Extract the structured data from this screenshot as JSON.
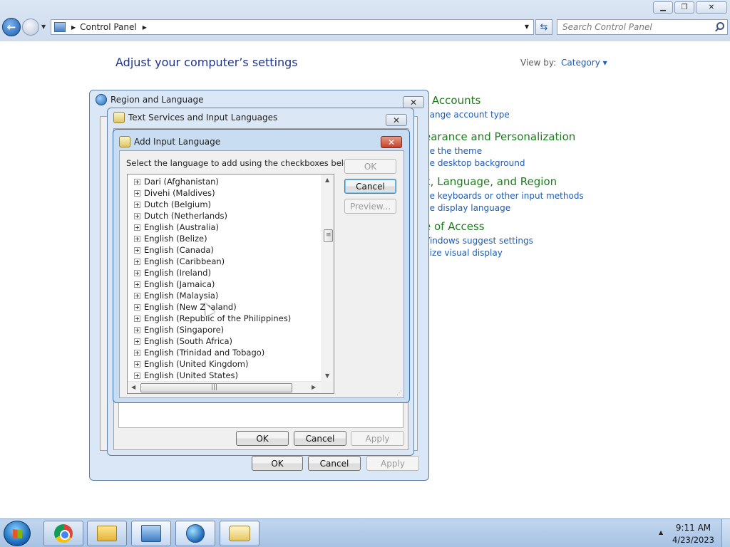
{
  "explorer": {
    "address": "Control Panel",
    "search_placeholder": "Search Control Panel",
    "minimize": "▁",
    "maximize": "❐",
    "close": "✕"
  },
  "control_panel": {
    "heading": "Adjust your computer’s settings",
    "view_by_label": "View by:",
    "view_by_value": "Category ▾",
    "categories": [
      {
        "title": "r Accounts",
        "links": [
          "hange account type"
        ]
      },
      {
        "title": "earance and Personalization",
        "links": [
          "ge the theme",
          "ge desktop background"
        ]
      },
      {
        "title": "k, Language, and Region",
        "links": [
          "ge keyboards or other input methods",
          "ge display language"
        ]
      },
      {
        "title": "e of Access",
        "links": [
          "Vindows suggest settings",
          "nize visual display"
        ]
      }
    ]
  },
  "region_dialog": {
    "title": "Region and Language",
    "buttons": {
      "ok": "OK",
      "cancel": "Cancel",
      "apply": "Apply"
    }
  },
  "text_services_dialog": {
    "title": "Text Services and Input Languages",
    "buttons": {
      "ok": "OK",
      "cancel": "Cancel",
      "apply": "Apply"
    }
  },
  "add_language_dialog": {
    "title": "Add Input Language",
    "instruction": "Select the language to add using the checkboxes below.",
    "buttons": {
      "ok": "OK",
      "cancel": "Cancel",
      "preview": "Preview..."
    },
    "languages": [
      "Dari (Afghanistan)",
      "Divehi (Maldives)",
      "Dutch (Belgium)",
      "Dutch (Netherlands)",
      "English (Australia)",
      "English (Belize)",
      "English (Canada)",
      "English (Caribbean)",
      "English (Ireland)",
      "English (Jamaica)",
      "English (Malaysia)",
      "English (New Zealand)",
      "English (Republic of the Philippines)",
      "English (Singapore)",
      "English (South Africa)",
      "English (Trinidad and Tobago)",
      "English (United Kingdom)",
      "English (United States)"
    ],
    "scroll_grip": "≡",
    "hscroll_grip": "|||"
  },
  "taskbar": {
    "apps": [
      "chrome-icon",
      "folder-icon",
      "control-panel-icon",
      "region-globe-icon",
      "keyboard-icon"
    ],
    "time": "9:11 AM",
    "date": "4/23/2023"
  }
}
